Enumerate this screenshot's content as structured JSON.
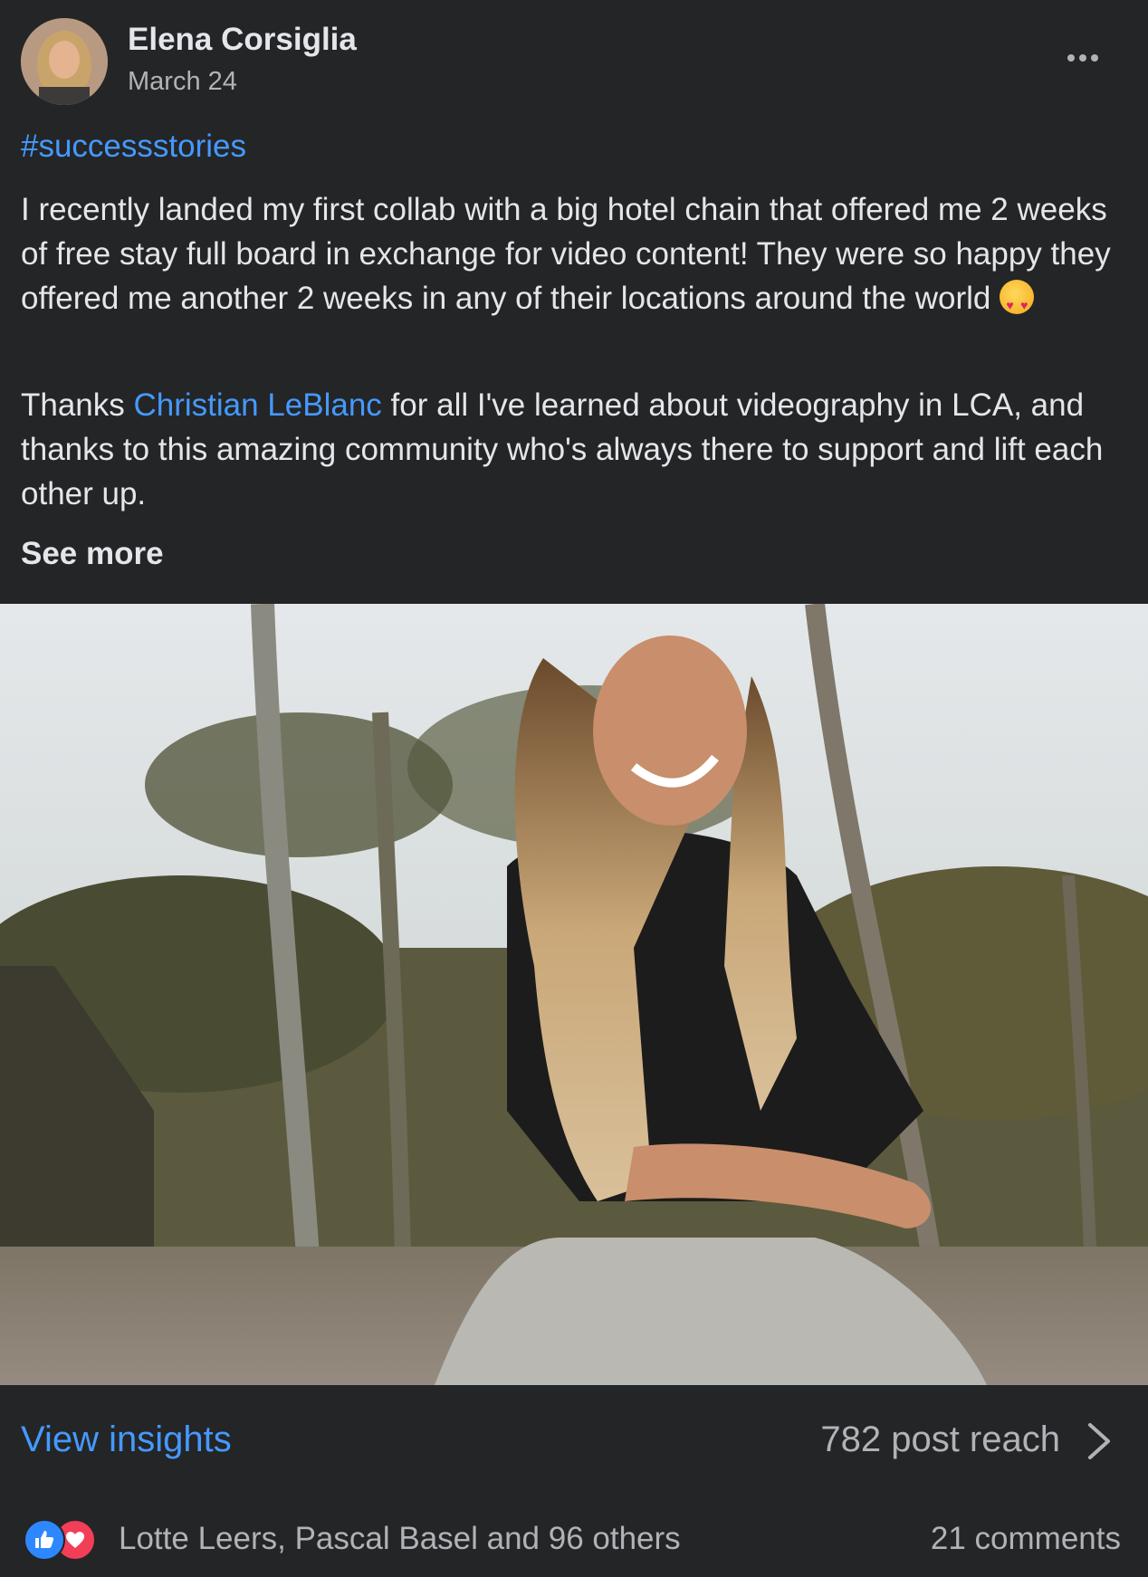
{
  "post": {
    "author": "Elena Corsiglia",
    "date": "March 24",
    "hashtag": "#successstories",
    "paragraph1": "I recently landed my first collab with a big hotel chain that offered me 2 weeks of free stay full board in exchange for video content! They were so happy they offered me another 2 weeks in any of their locations around the world",
    "paragraph1_emoji": "star-struck-emoji",
    "paragraph2_prefix": "Thanks ",
    "mention": "Christian LeBlanc",
    "paragraph2_suffix": " for all I've learned about videography in LCA, and thanks to this amazing community who's always there to support and lift each other up.",
    "see_more": "See more"
  },
  "insights": {
    "link": "View insights",
    "reach": "782 post reach"
  },
  "engagement": {
    "reactions": [
      "like-icon",
      "love-icon"
    ],
    "liked_by": "Lotte Leers, Pascal Basel and 96 others",
    "comments": "21 comments"
  },
  "colors": {
    "background": "#242526",
    "link": "#4599ff",
    "text_primary": "#e4e6eb",
    "text_secondary": "#b0b3b8",
    "like": "#2d88ff",
    "love": "#f33e58"
  }
}
